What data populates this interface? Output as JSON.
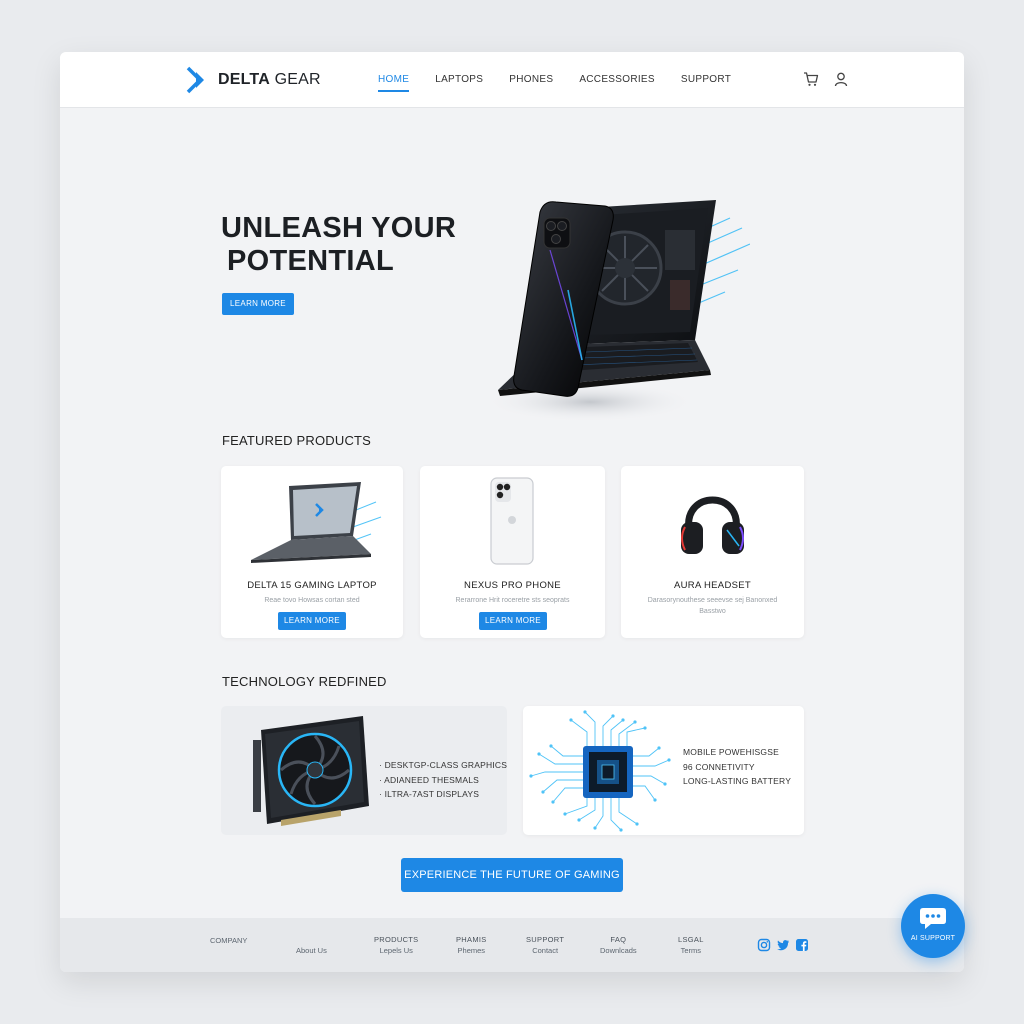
{
  "brand": {
    "name_bold": "DELTA",
    "name_light": " GEAR"
  },
  "nav": {
    "items": [
      "HOME",
      "LAPTOPS",
      "PHONES",
      "ACCESSORIES",
      "SUPPORT"
    ],
    "active": "HOME"
  },
  "header_icons": [
    "cart-icon",
    "user-icon"
  ],
  "hero": {
    "title_line1": "UNLEASH YOUR",
    "title_line2": "POTENTIAL",
    "button": "LEARN MORE"
  },
  "featured": {
    "title": "FEATURED PRODUCTS",
    "products": [
      {
        "name": "DELTA 15 GAMING LAPTOP",
        "desc": "Reae tovo Howsas cortan sted",
        "button": "LEARN MORE"
      },
      {
        "name": "NEXUS PRO PHONE",
        "desc": "Rerarrone Hrit roceretre sts seoprats",
        "button": "LEARN MORE"
      },
      {
        "name": "AURA HEADSET",
        "desc": "Darasorynouthese seeevse sej Banonxed",
        "desc2": "Basstwo"
      }
    ]
  },
  "tech": {
    "title": "TECHNOLOGY REDFINED",
    "left_features": [
      "· DESKTGP-CLASS GRAPHICS",
      "· ADIANEED THESMALS",
      "· ILTRA-7AST DISPLAYS"
    ],
    "right_features": [
      "MOBILE POWEHISGSE",
      "96 CONNETIVITY",
      "LONG-LASTING BATTERY"
    ]
  },
  "cta": "EXPERIENCE THE FUTURE OF GAMING",
  "footer": {
    "company": "COMPANY",
    "about": "About Us",
    "columns": [
      {
        "head": "PRODUCTS",
        "link": "Lepels Us"
      },
      {
        "head": "PHAMIS",
        "link": "Phemes"
      },
      {
        "head": "SUPPORT",
        "link": "Contact"
      },
      {
        "head": "FAQ",
        "link": "Downlcads"
      },
      {
        "head": "LSGAL",
        "link": "Terms"
      }
    ],
    "social": [
      "instagram-icon",
      "twitter-icon",
      "facebook-icon"
    ]
  },
  "ai_support": "AI SUPPORT",
  "colors": {
    "accent": "#1e88e5",
    "page_bg": "#f2f3f5",
    "footer_bg": "#e6e8eb"
  }
}
